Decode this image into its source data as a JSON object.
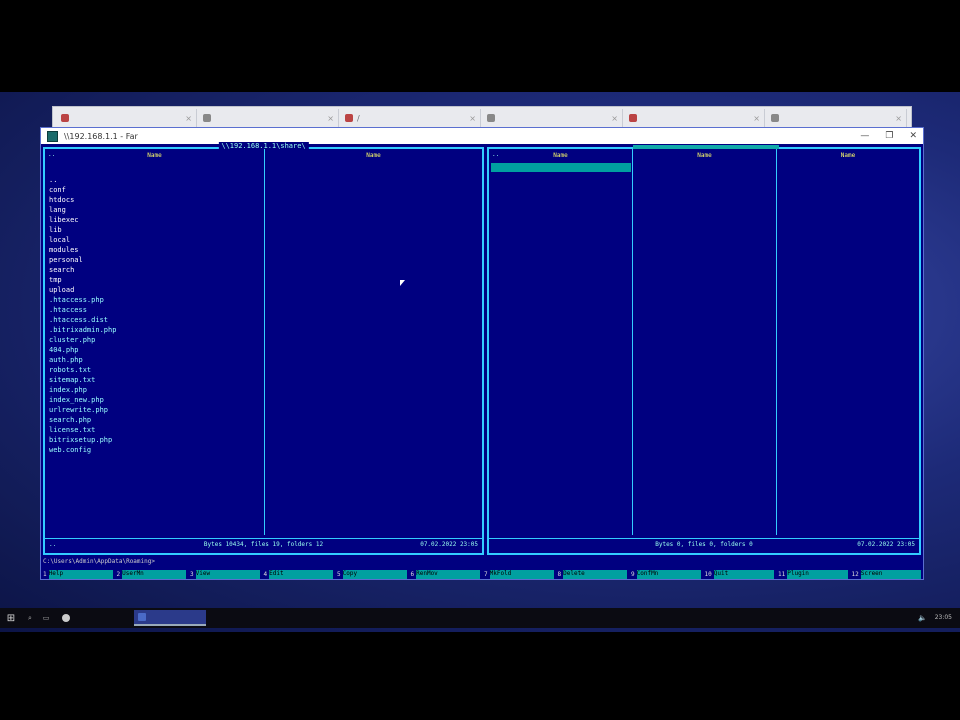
{
  "browser": {
    "tabs": [
      {
        "title": "",
        "icon": "favicon-icon"
      },
      {
        "title": "",
        "icon": "favicon-icon"
      },
      {
        "title": "/",
        "icon": "favicon-icon"
      },
      {
        "title": "",
        "icon": "favicon-icon"
      },
      {
        "title": "",
        "icon": "favicon-icon"
      },
      {
        "title": "",
        "icon": "favicon-icon"
      }
    ]
  },
  "window": {
    "title": "\\\\192.168.1.1 - Far"
  },
  "left_panel": {
    "path": "\\\\192.168.1.1\\share\\",
    "columns": [
      "Name",
      "Name"
    ],
    "updir": "..",
    "files": [
      {
        "name": "..",
        "dir": true
      },
      {
        "name": "conf",
        "dir": true
      },
      {
        "name": "htdocs",
        "dir": true
      },
      {
        "name": "lang",
        "dir": true
      },
      {
        "name": "libexec",
        "dir": true
      },
      {
        "name": "lib",
        "dir": true
      },
      {
        "name": "local",
        "dir": true
      },
      {
        "name": "modules",
        "dir": true
      },
      {
        "name": "personal",
        "dir": true
      },
      {
        "name": "search",
        "dir": true
      },
      {
        "name": "tmp",
        "dir": true
      },
      {
        "name": "upload",
        "dir": true
      },
      {
        "name": ".htaccess.php",
        "dir": false
      },
      {
        "name": ".htaccess",
        "dir": false
      },
      {
        "name": ".htaccess.dist",
        "dir": false
      },
      {
        "name": ".bitrixadmin.php",
        "dir": false
      },
      {
        "name": "cluster.php",
        "dir": false
      },
      {
        "name": "404.php",
        "dir": false
      },
      {
        "name": "auth.php",
        "dir": false
      },
      {
        "name": "robots.txt",
        "dir": false
      },
      {
        "name": "sitemap.txt",
        "dir": false
      },
      {
        "name": "index.php",
        "dir": false
      },
      {
        "name": "index_new.php",
        "dir": false
      },
      {
        "name": "urlrewrite.php",
        "dir": false
      },
      {
        "name": "search.php",
        "dir": false
      },
      {
        "name": "license.txt",
        "dir": false
      },
      {
        "name": "bitrixsetup.php",
        "dir": false
      },
      {
        "name": "web.config",
        "dir": false
      }
    ],
    "status_left": "..",
    "status_mid": "Bytes 10434, files 19, folders 12",
    "status_right": "07.02.2022 23:05"
  },
  "right_panel": {
    "path": "",
    "columns": [
      "Name",
      "Name",
      "Name"
    ],
    "updir": "..",
    "status_mid": "Bytes 0, files 0, folders 0",
    "status_right": "07.02.2022 23:05"
  },
  "command_line": "C:\\Users\\Admin\\AppData\\Roaming>",
  "keybar": [
    {
      "n": "1",
      "label": "Help"
    },
    {
      "n": "2",
      "label": "UserMn"
    },
    {
      "n": "3",
      "label": "View"
    },
    {
      "n": "4",
      "label": "Edit"
    },
    {
      "n": "5",
      "label": "Copy"
    },
    {
      "n": "6",
      "label": "RenMov"
    },
    {
      "n": "7",
      "label": "MkFold"
    },
    {
      "n": "8",
      "label": "Delete"
    },
    {
      "n": "9",
      "label": "ConfMn"
    },
    {
      "n": "10",
      "label": "Quit"
    },
    {
      "n": "11",
      "label": "Plugin"
    },
    {
      "n": "12",
      "label": "Screen"
    }
  ],
  "taskbar": {
    "apps": [
      {
        "label": "",
        "active": false
      },
      {
        "label": "",
        "active": true
      }
    ],
    "clock_time": "23:05",
    "clock_date": ""
  },
  "colors": {
    "panel_bg": "#000080",
    "frame": "#33ccff",
    "cursor": "#00a0a0",
    "header": "#ffff66"
  }
}
